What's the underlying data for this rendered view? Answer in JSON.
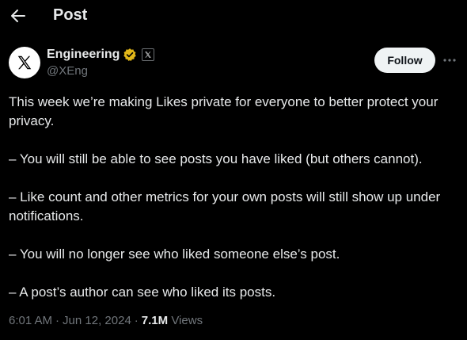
{
  "header": {
    "title": "Post",
    "back_icon": "arrow-left-icon"
  },
  "author": {
    "name": "Engineering",
    "handle": "@XEng",
    "avatar_icon": "x-logo-icon",
    "verified_icon": "gold-verified-badge-icon",
    "affiliation_icon": "x-affiliate-badge-icon"
  },
  "actions": {
    "follow_label": "Follow",
    "more_icon": "more-horizontal-icon"
  },
  "post": {
    "paragraphs": [
      "This week we’re making Likes private for everyone to better protect your privacy.",
      "– You will still be able to see posts you have liked (but others cannot).",
      "– Like count and other metrics for your own posts will still show up under notifications.",
      "– You will no longer see who liked someone else’s post.",
      "– A post’s author can see who liked its posts."
    ]
  },
  "meta": {
    "time": "6:01 AM",
    "date": "Jun 12, 2024",
    "views_count": "7.1M",
    "views_label": "Views",
    "separator": "·"
  },
  "colors": {
    "background": "#000000",
    "text": "#e7e9ea",
    "secondary": "#71767b",
    "verified": "#e2b719",
    "follow_bg": "#eff3f4"
  }
}
